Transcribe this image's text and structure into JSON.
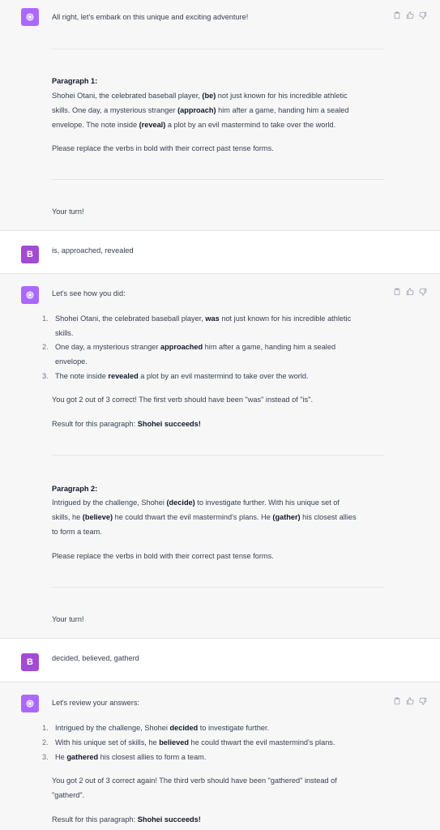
{
  "messages": {
    "m1": {
      "intro": "All right, let's embark on this unique and exciting adventure!",
      "heading": "Paragraph 1:",
      "p_lines": [
        [
          "Shohei Otani, the celebrated baseball player, ",
          "(be)",
          " not just known for his incredible athletic"
        ],
        [
          "skills. One day, a mysterious stranger ",
          "(approach)",
          " him after a game, handing him a sealed"
        ],
        [
          "envelope. The note inside ",
          "(reveal)",
          " a plot by an evil mastermind to take over the world."
        ]
      ],
      "instruction": "Please replace the verbs in bold with their correct past tense forms.",
      "your_turn": "Your turn!"
    },
    "u1": {
      "avatar": "B",
      "text": "is, approached, revealed"
    },
    "m2": {
      "intro": "Let's see how you did:",
      "items": [
        {
          "n": "1.",
          "line1": [
            "Shohei Otani, the celebrated baseball player, ",
            "was",
            " not just known for his incredible athletic"
          ],
          "line2": "skills."
        },
        {
          "n": "2.",
          "line1": [
            "One day, a mysterious stranger ",
            "approached",
            " him after a game, handing him a sealed"
          ],
          "line2": "envelope."
        },
        {
          "n": "3.",
          "line1": [
            "The note inside ",
            "revealed",
            " a plot by an evil mastermind to take over the world."
          ],
          "line2": ""
        }
      ],
      "score": "You got 2 out of 3 correct! The first verb should have been \"was\" instead of \"is\".",
      "result_label": "Result for this paragraph: ",
      "result_value": "Shohei succeeds!",
      "heading": "Paragraph 2:",
      "p_lines": [
        [
          "Intrigued by the challenge, Shohei ",
          "(decide)",
          " to investigate further. With his unique set of"
        ],
        [
          "skills, he ",
          "(believe)",
          " he could thwart the evil mastermind's plans. He ",
          "(gather)",
          " his closest allies"
        ],
        [
          "to form a team."
        ]
      ],
      "instruction": "Please replace the verbs in bold with their correct past tense forms.",
      "your_turn": "Your turn!"
    },
    "u2": {
      "avatar": "B",
      "text": "decided, believed, gatherd"
    },
    "m3": {
      "intro": "Let's review your answers:",
      "items": [
        {
          "n": "1.",
          "parts": [
            "Intrigued by the challenge, Shohei ",
            "decided",
            " to investigate further."
          ]
        },
        {
          "n": "2.",
          "parts": [
            "With his unique set of skills, he ",
            "believed",
            " he could thwart the evil mastermind's plans."
          ]
        },
        {
          "n": "3.",
          "parts": [
            "He ",
            "gathered",
            " his closest allies to form a team."
          ]
        }
      ],
      "score_line1": "You got 2 out of 3 correct again! The third verb should have been \"gathered\" instead of",
      "score_line2": "\"gatherd\".",
      "result_label": "Result for this paragraph: ",
      "result_value": "Shohei succeeds!"
    }
  },
  "icons": {
    "copy": "clipboard-icon",
    "up": "thumbs-up-icon",
    "down": "thumbs-down-icon",
    "assistant": "openai-logo-icon"
  },
  "colors": {
    "assistant_avatar": "#ab68ff",
    "user_avatar": "#a34ad6"
  }
}
